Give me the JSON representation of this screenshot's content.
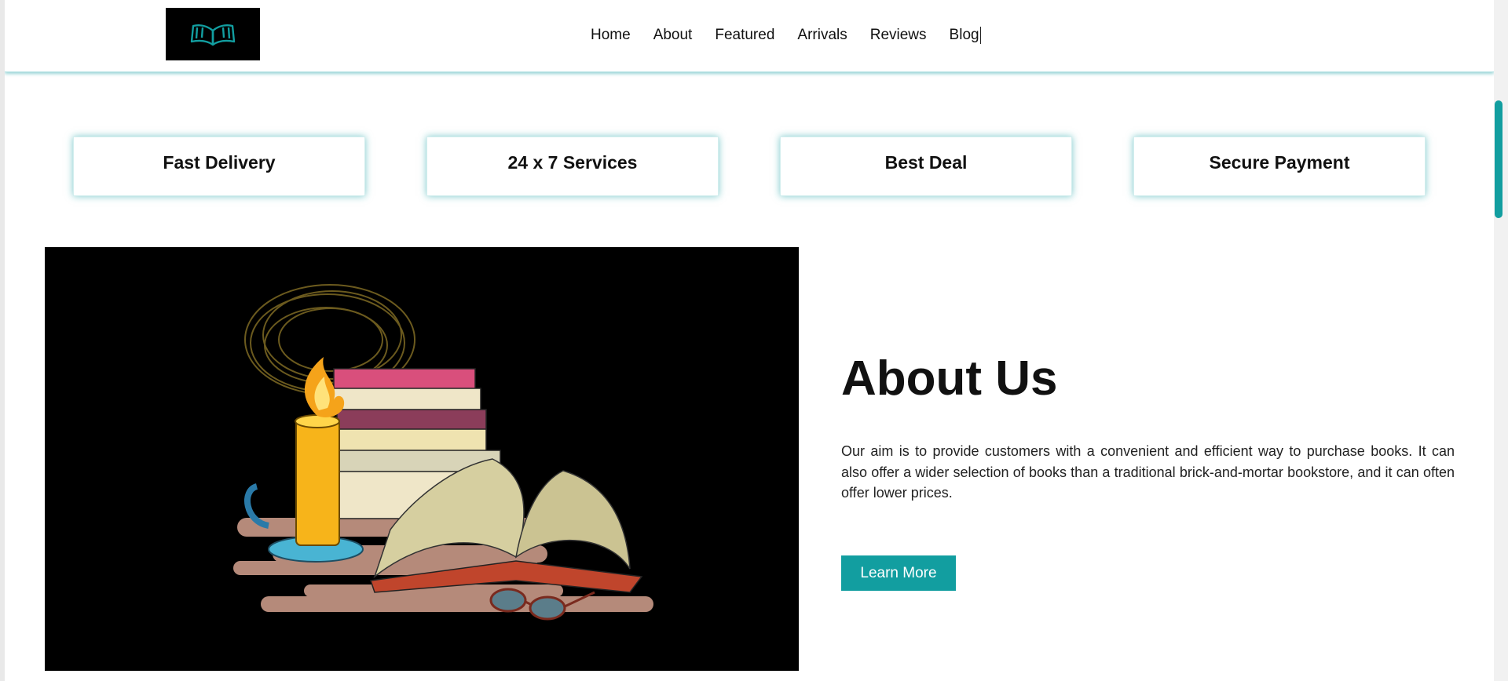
{
  "colors": {
    "accent": "#129ea0",
    "logo_bg": "#000000",
    "text": "#111111"
  },
  "header": {
    "logo_icon": "open-book-icon",
    "nav": [
      {
        "label": "Home"
      },
      {
        "label": "About"
      },
      {
        "label": "Featured"
      },
      {
        "label": "Arrivals"
      },
      {
        "label": "Reviews"
      },
      {
        "label": "Blog"
      }
    ]
  },
  "features": [
    {
      "label": "Fast Delivery"
    },
    {
      "label": "24 x 7 Services"
    },
    {
      "label": "Best Deal"
    },
    {
      "label": "Secure Payment"
    }
  ],
  "about": {
    "image_alt_icon": "books-candle-illustration",
    "title": "About Us",
    "text": "Our aim is to provide customers with a convenient and efficient way to purchase books. It can also offer a wider selection of books than a traditional brick-and-mortar bookstore, and it can often offer lower prices.",
    "button_label": "Learn More"
  }
}
